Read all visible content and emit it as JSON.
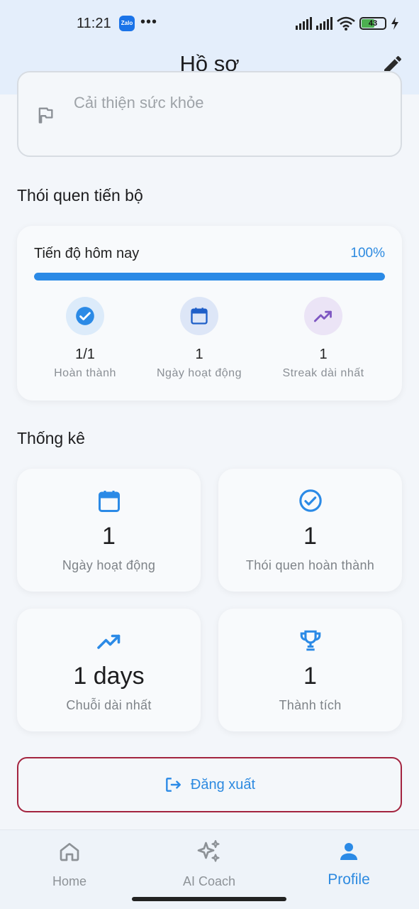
{
  "status_bar": {
    "time": "11:21",
    "zalo": "Zalo",
    "dots": "•••",
    "battery": "43"
  },
  "header": {
    "title": "Hồ sơ"
  },
  "goal": {
    "text": "Cải thiện sức khỏe"
  },
  "habit_section": {
    "title": "Thói quen tiến bộ",
    "today_label": "Tiến độ hôm nay",
    "percent_text": "100%",
    "progress_fraction": 1.0,
    "items": [
      {
        "value": "1/1",
        "label": "Hoàn thành",
        "icon": "check-circle-icon"
      },
      {
        "value": "1",
        "label": "Ngày hoạt động",
        "icon": "calendar-icon"
      },
      {
        "value": "1",
        "label": "Streak dài nhất",
        "icon": "trending-up-icon"
      }
    ]
  },
  "stats_section": {
    "title": "Thống kê",
    "cards": [
      {
        "value": "1",
        "label": "Ngày hoạt động",
        "icon": "calendar-icon"
      },
      {
        "value": "1",
        "label": "Thói quen hoàn thành",
        "icon": "check-circle-icon"
      },
      {
        "value": "1 days",
        "label": "Chuỗi dài nhất",
        "icon": "trending-up-icon"
      },
      {
        "value": "1",
        "label": "Thành tích",
        "icon": "trophy-icon"
      }
    ]
  },
  "logout": {
    "label": "Đăng xuất"
  },
  "nav": [
    {
      "label": "Home",
      "icon": "home-icon",
      "active": false
    },
    {
      "label": "AI Coach",
      "icon": "sparkle-icon",
      "active": false
    },
    {
      "label": "Profile",
      "icon": "person-icon",
      "active": true
    }
  ],
  "colors": {
    "accent": "#2b8ae6",
    "logout_border": "#a3243f",
    "purple": "#7e57c2"
  }
}
